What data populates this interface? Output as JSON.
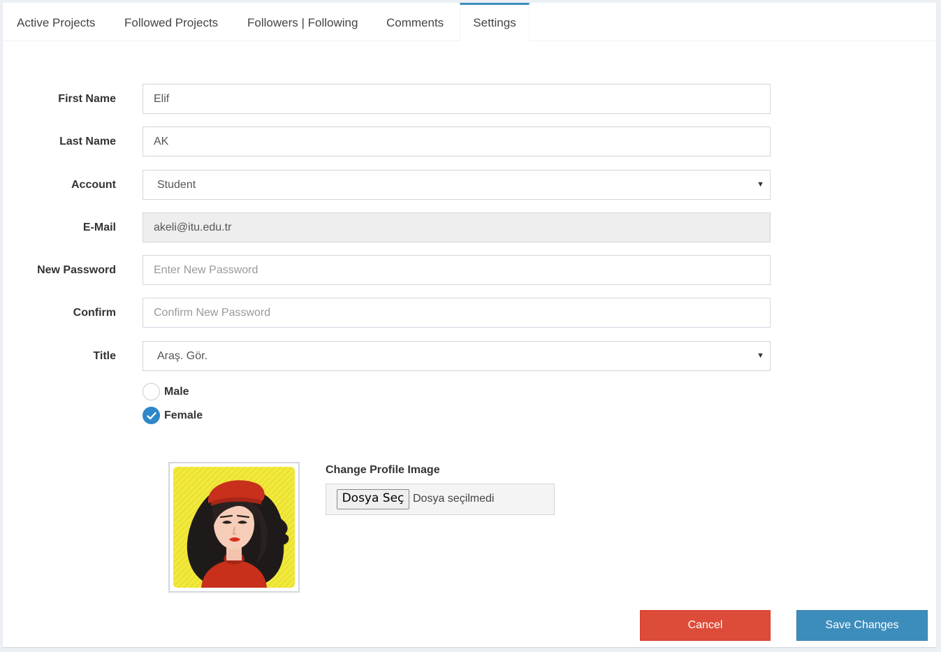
{
  "tabs": [
    {
      "label": "Active Projects"
    },
    {
      "label": "Followed Projects"
    },
    {
      "label": "Followers | Following"
    },
    {
      "label": "Comments"
    },
    {
      "label": "Settings",
      "active": true
    }
  ],
  "form": {
    "first_name": {
      "label": "First Name",
      "value": "Elif"
    },
    "last_name": {
      "label": "Last Name",
      "value": "AK"
    },
    "account": {
      "label": "Account",
      "selected": "Student"
    },
    "email": {
      "label": "E-Mail",
      "value": "akeli@itu.edu.tr"
    },
    "new_password": {
      "label": "New Password",
      "placeholder": "Enter New Password"
    },
    "confirm": {
      "label": "Confirm",
      "placeholder": "Confirm New Password"
    },
    "title": {
      "label": "Title",
      "selected": "Araş. Gör."
    },
    "gender": {
      "male": {
        "label": "Male",
        "checked": false
      },
      "female": {
        "label": "Female",
        "checked": true
      }
    }
  },
  "profile_image": {
    "heading": "Change Profile Image",
    "choose_button": "Dosya Seç",
    "file_status": "Dosya seçilmedi"
  },
  "actions": {
    "cancel": "Cancel",
    "save": "Save Changes"
  },
  "colors": {
    "tab_accent": "#3c8dbc",
    "radio_checked": "#2f86c8",
    "cancel": "#dd4b39",
    "save": "#3c8dbc"
  }
}
